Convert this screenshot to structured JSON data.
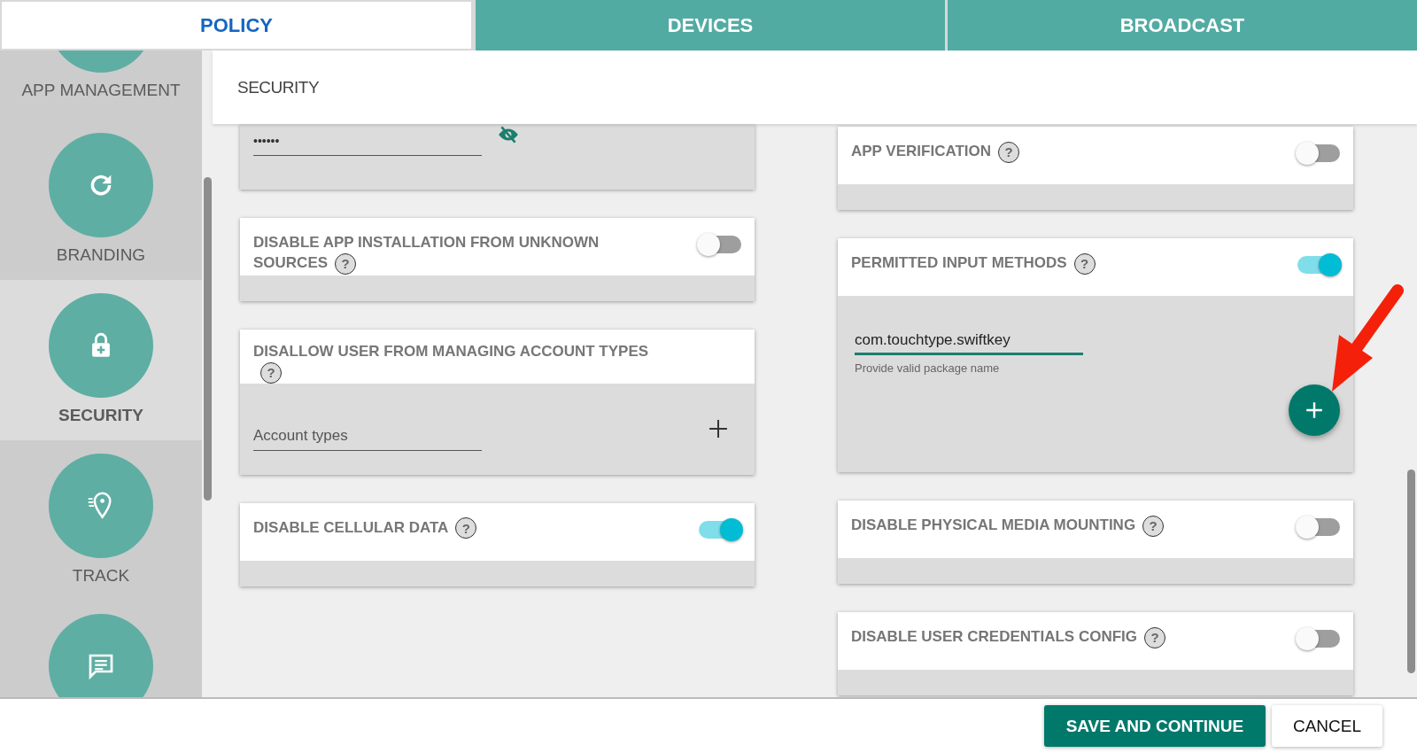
{
  "tabs": [
    {
      "label": "POLICY",
      "selected": true
    },
    {
      "label": "DEVICES",
      "selected": false
    },
    {
      "label": "BROADCAST",
      "selected": false
    }
  ],
  "sidebar": {
    "items": [
      {
        "label": "APP MANAGEMENT",
        "selected": false
      },
      {
        "label": "BRANDING",
        "selected": false
      },
      {
        "label": "SECURITY",
        "selected": true
      },
      {
        "label": "TRACK",
        "selected": false
      },
      {
        "selected": false
      }
    ]
  },
  "section_title": "SECURITY",
  "left_cards": [
    {
      "kind": "password",
      "value": "••••••"
    },
    {
      "kind": "toggle",
      "title": "DISABLE APP INSTALLATION FROM UNKNOWN SOURCES",
      "help": "?",
      "on": false
    },
    {
      "kind": "list-input",
      "title": "DISALLOW USER FROM MANAGING ACCOUNT TYPES",
      "help": "?",
      "placeholder": "Account types"
    },
    {
      "kind": "toggle",
      "title": "DISABLE CELLULAR DATA",
      "help": "?",
      "on": true
    }
  ],
  "right_cards": [
    {
      "kind": "toggle",
      "title": "APP VERIFICATION",
      "help": "?",
      "on": false
    },
    {
      "kind": "toggle-input",
      "title": "PERMITTED INPUT METHODS",
      "help": "?",
      "on": true,
      "value": "com.touchtype.swiftkey",
      "hint": "Provide valid package name"
    },
    {
      "kind": "toggle",
      "title": "DISABLE PHYSICAL MEDIA MOUNTING",
      "help": "?",
      "on": false
    },
    {
      "kind": "toggle",
      "title": "DISABLE USER CREDENTIALS CONFIG",
      "help": "?",
      "on": false
    }
  ],
  "buttons": [
    {
      "label": "SAVE AND CONTINUE",
      "kind": "primary"
    },
    {
      "label": "CANCEL",
      "kind": "secondary"
    }
  ]
}
